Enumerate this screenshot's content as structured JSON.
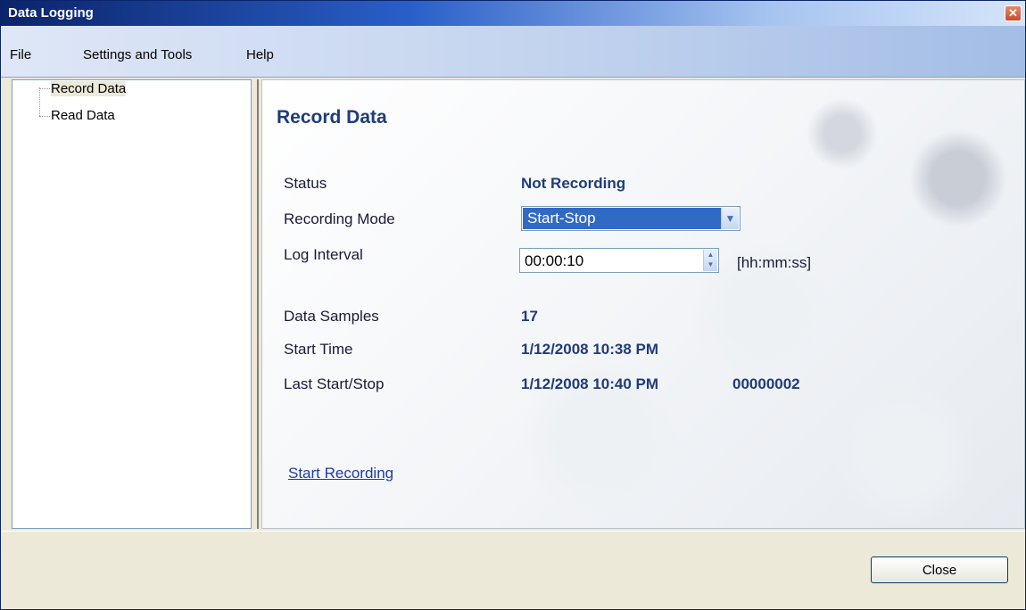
{
  "window": {
    "title": "Data Logging",
    "close_glyph": "✕"
  },
  "menu": {
    "items": [
      "File",
      "Settings and Tools",
      "Help"
    ]
  },
  "tree": {
    "items": [
      "Record Data",
      "Read Data"
    ]
  },
  "panel": {
    "title": "Record Data",
    "status_label": "Status",
    "status_value": "Not Recording",
    "mode_label": "Recording Mode",
    "mode_value": "Start-Stop",
    "interval_label": "Log Interval",
    "interval_value": "00:00:10",
    "interval_unit": "[hh:mm:ss]",
    "samples_label": "Data Samples",
    "samples_value": "17",
    "start_label": "Start Time",
    "start_value": "1/12/2008 10:38 PM",
    "last_label": "Last Start/Stop",
    "last_value": "1/12/2008 10:40 PM",
    "last_count": "00000002",
    "action_link": "Start Recording"
  },
  "footer": {
    "close_label": "Close"
  },
  "icons": {
    "select_arrow": "chevron-down-icon",
    "spin": "spin-updown-icon",
    "close": "close-icon"
  },
  "colors": {
    "title_blue": "#1f3c7a",
    "selection": "#316ac5",
    "link": "#1f3ca8"
  }
}
